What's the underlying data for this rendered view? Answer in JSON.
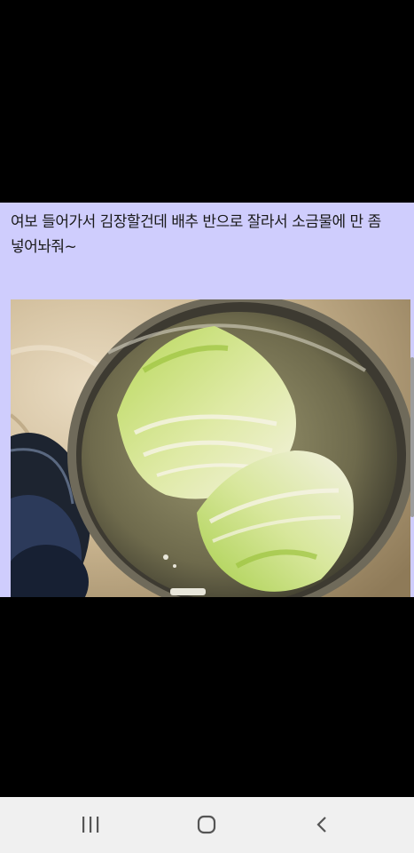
{
  "post": {
    "caption": "여보 들어가서 김장할건데 배추 반으로 잘라서 소금물에 만 좀 넣어놔줘~"
  },
  "photo": {
    "subject": "napa-cabbage-halves-in-steel-pot"
  },
  "navbar": {
    "recents_icon": "recents-icon",
    "home_icon": "home-icon",
    "back_icon": "back-icon"
  },
  "colors": {
    "caption_background": "#cfcdfd",
    "navbar_background": "#f0f0f0",
    "nav_icon": "#555555",
    "viewer_background": "#000000"
  }
}
